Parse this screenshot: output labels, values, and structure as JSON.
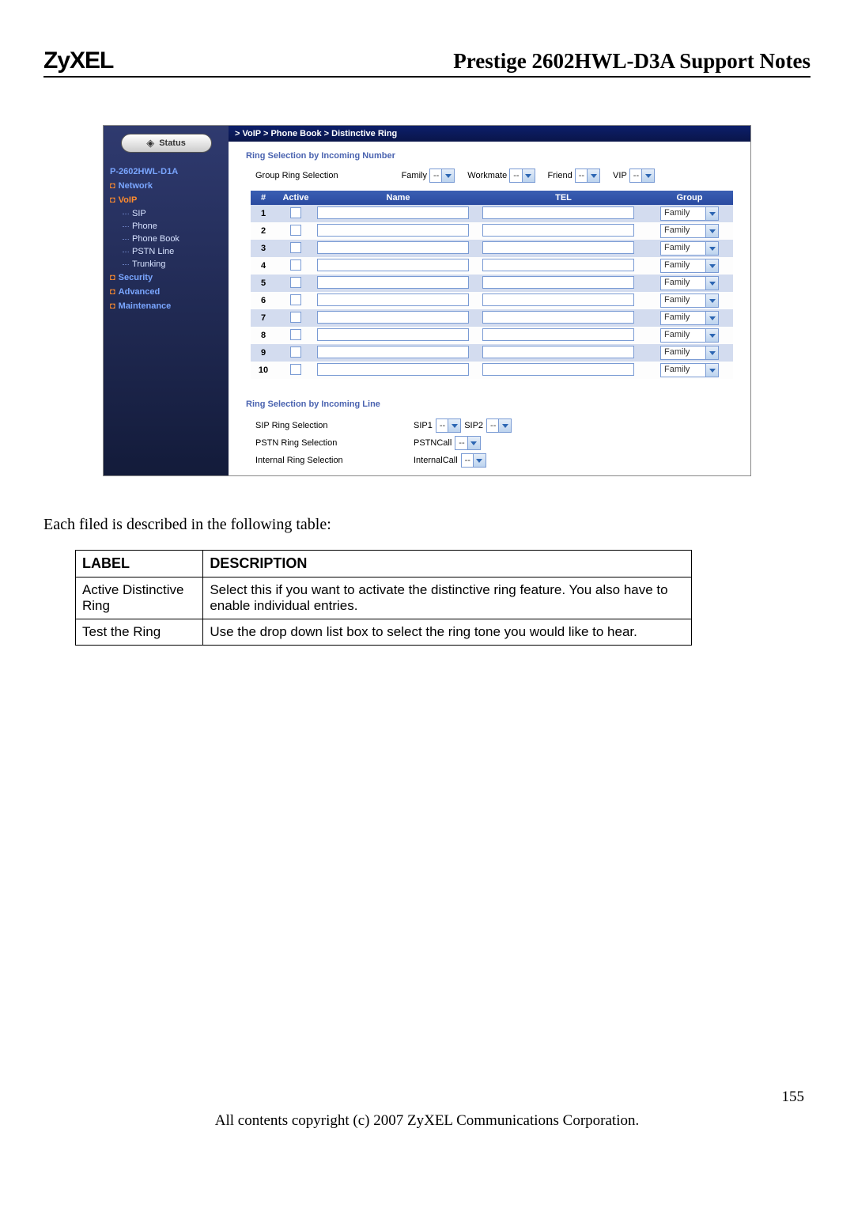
{
  "header": {
    "logo": "ZyXEL",
    "title": "Prestige 2602HWL-D3A Support Notes"
  },
  "sidebar": {
    "status_label": "Status",
    "model": "P-2602HWL-D1A",
    "items": [
      {
        "label": "Network",
        "kind": "main"
      },
      {
        "label": "VoIP",
        "kind": "main-orange"
      },
      {
        "label": "SIP",
        "kind": "sub"
      },
      {
        "label": "Phone",
        "kind": "sub"
      },
      {
        "label": "Phone Book",
        "kind": "sub"
      },
      {
        "label": "PSTN Line",
        "kind": "sub"
      },
      {
        "label": "Trunking",
        "kind": "sub"
      },
      {
        "label": "Security",
        "kind": "main"
      },
      {
        "label": "Advanced",
        "kind": "main"
      },
      {
        "label": "Maintenance",
        "kind": "main"
      }
    ]
  },
  "breadcrumb": "> VoIP > Phone Book > Distinctive Ring",
  "section1": {
    "title": "Ring Selection by Incoming Number",
    "group_label": "Group Ring Selection",
    "groups": [
      {
        "name": "Family",
        "value": "--"
      },
      {
        "name": "Workmate",
        "value": "--"
      },
      {
        "name": "Friend",
        "value": "--"
      },
      {
        "name": "VIP",
        "value": "--"
      }
    ],
    "columns": {
      "num": "#",
      "active": "Active",
      "name": "Name",
      "tel": "TEL",
      "group": "Group"
    },
    "rows": [
      {
        "num": "1",
        "group": "Family"
      },
      {
        "num": "2",
        "group": "Family"
      },
      {
        "num": "3",
        "group": "Family"
      },
      {
        "num": "4",
        "group": "Family"
      },
      {
        "num": "5",
        "group": "Family"
      },
      {
        "num": "6",
        "group": "Family"
      },
      {
        "num": "7",
        "group": "Family"
      },
      {
        "num": "8",
        "group": "Family"
      },
      {
        "num": "9",
        "group": "Family"
      },
      {
        "num": "10",
        "group": "Family"
      }
    ]
  },
  "section2": {
    "title": "Ring Selection by Incoming Line",
    "rows": [
      {
        "label": "SIP Ring Selection",
        "pairs": [
          {
            "name": "SIP1",
            "value": "--"
          },
          {
            "name": "SIP2",
            "value": "--"
          }
        ]
      },
      {
        "label": "PSTN Ring Selection",
        "pairs": [
          {
            "name": "PSTNCall",
            "value": "--"
          }
        ]
      },
      {
        "label": "Internal Ring Selection",
        "pairs": [
          {
            "name": "InternalCall",
            "value": "--"
          }
        ]
      }
    ]
  },
  "intro_text": "Each filed is described in the following table:",
  "desc_table": {
    "h1": "LABEL",
    "h2": "DESCRIPTION",
    "rows": [
      {
        "label": "Active Distinctive Ring",
        "desc": "Select this if you want to activate the distinctive ring feature. You also have to enable individual entries."
      },
      {
        "label": "Test the Ring",
        "desc": "Use the drop down list box to select the ring tone you would like to hear."
      }
    ]
  },
  "page_number": "155",
  "copyright": "All contents copyright (c) 2007 ZyXEL Communications Corporation."
}
